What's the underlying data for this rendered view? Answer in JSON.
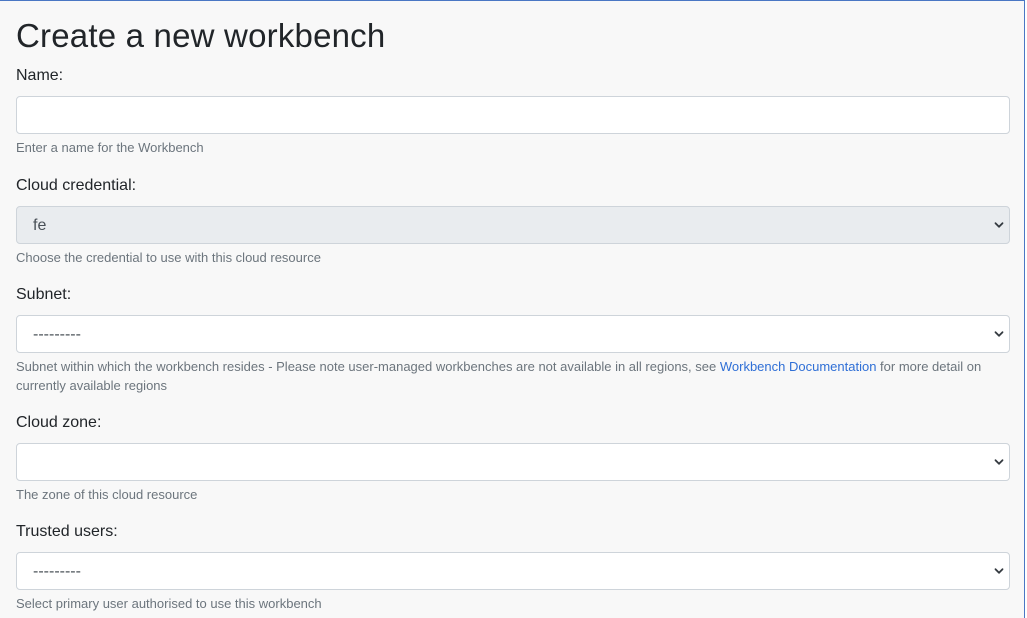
{
  "page": {
    "title": "Create a new workbench"
  },
  "form": {
    "name": {
      "label": "Name:",
      "value": "",
      "help": "Enter a name for the Workbench"
    },
    "cloud_credential": {
      "label": "Cloud credential:",
      "selected": "fe",
      "help": "Choose the credential to use with this cloud resource"
    },
    "subnet": {
      "label": "Subnet:",
      "selected": "---------",
      "help_prefix": "Subnet within which the workbench resides - Please note user-managed workbenches are not available in all regions, see ",
      "help_link": "Workbench Documentation",
      "help_suffix": " for more detail on currently available regions"
    },
    "cloud_zone": {
      "label": "Cloud zone:",
      "selected": "",
      "help": "The zone of this cloud resource"
    },
    "trusted_users": {
      "label": "Trusted users:",
      "selected": "---------",
      "help": "Select primary user authorised to use this workbench"
    }
  },
  "colors": {
    "accent": "#4a77c4",
    "link": "#2f6fd6",
    "disabled_bg": "#e9ecef"
  }
}
